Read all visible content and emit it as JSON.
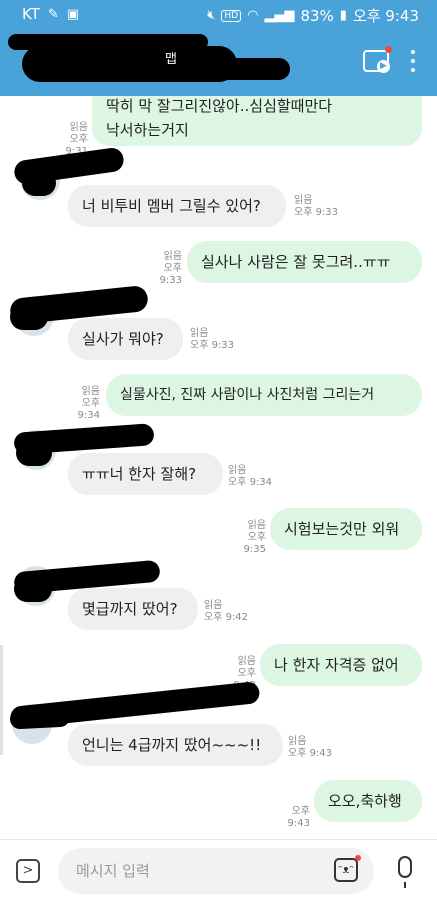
{
  "status_bar": {
    "carrier": "KT",
    "battery": "83%",
    "time": "오후 9:43",
    "icons": [
      "edit-icon",
      "screenshot-icon",
      "mute-icon",
      "hd-icon",
      "wifi-icon",
      "signal-icon",
      "battery-icon"
    ]
  },
  "header": {
    "title_partial": "맵"
  },
  "messages": [
    {
      "id": "m0",
      "side": "out",
      "text": "딱히 막 잘그리진않아..심심할때만다",
      "text2": "낙서하는거지",
      "read": "읽음",
      "time": "오후 9:31"
    },
    {
      "id": "m1",
      "side": "in",
      "text": "너 비투비 멤버 그릴수 있어?",
      "read": "읽음",
      "time": "오후 9:33"
    },
    {
      "id": "m2",
      "side": "out",
      "text": "실사나 사람은 잘 못그려..ㅠㅠ",
      "read": "읽음",
      "time": "오후 9:33"
    },
    {
      "id": "m3",
      "side": "in",
      "text": "실사가 뭐야?",
      "read": "읽음",
      "time": "오후 9:33"
    },
    {
      "id": "m4",
      "side": "out",
      "text": "실물사진, 진짜 사람이나 사진처럼 그리는거",
      "read": "읽음",
      "time": "오후 9:34"
    },
    {
      "id": "m5",
      "side": "in",
      "text": "ㅠㅠ너 한자 잘해?",
      "read": "읽음",
      "time": "오후 9:34"
    },
    {
      "id": "m6",
      "side": "out",
      "text": "시험보는것만 외워",
      "read": "읽음",
      "time": "오후 9:35"
    },
    {
      "id": "m7",
      "side": "in",
      "text": "몇급까지 땄어?",
      "read": "읽음",
      "time": "오후 9:42"
    },
    {
      "id": "m8",
      "side": "out",
      "text": "나 한자 자격증 없어",
      "read": "읽음",
      "time": "오후 9:42"
    },
    {
      "id": "m9",
      "side": "in",
      "text": "언니는 4급까지 땄어~~~!!",
      "read": "읽음",
      "time": "오후 9:43"
    },
    {
      "id": "m10",
      "side": "out",
      "text": "오오,축하행",
      "time": "오후 9:43"
    }
  ],
  "input": {
    "placeholder": "메시지 입력",
    "value": ""
  }
}
